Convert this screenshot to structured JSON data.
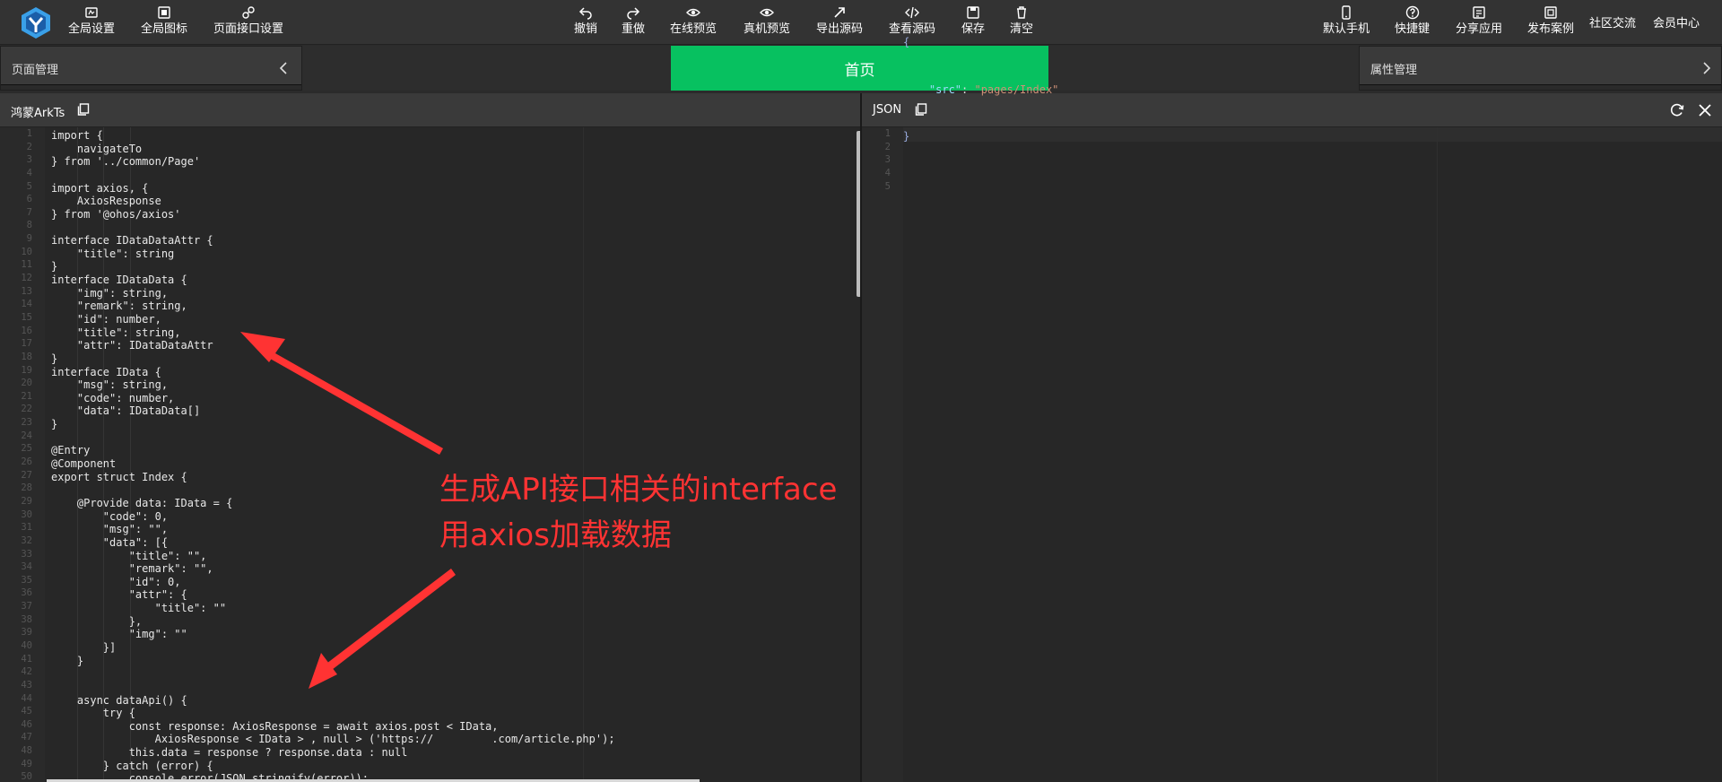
{
  "toolbar": {
    "left": [
      {
        "label": "全局设置",
        "icon": "global-settings-icon"
      },
      {
        "label": "全局图标",
        "icon": "global-icons-icon"
      },
      {
        "label": "页面接口设置",
        "icon": "page-api-settings-icon"
      }
    ],
    "center": [
      {
        "label": "撤销",
        "icon": "undo-icon"
      },
      {
        "label": "重做",
        "icon": "redo-icon"
      },
      {
        "label": "在线预览",
        "icon": "eye-icon"
      },
      {
        "label": "真机预览",
        "icon": "eye-icon"
      },
      {
        "label": "导出源码",
        "icon": "export-icon"
      },
      {
        "label": "查看源码",
        "icon": "code-icon"
      },
      {
        "label": "保存",
        "icon": "save-icon"
      },
      {
        "label": "清空",
        "icon": "trash-icon"
      }
    ],
    "right": [
      {
        "label": "默认手机",
        "icon": "phone-icon"
      },
      {
        "label": "快捷键",
        "icon": "help-icon"
      },
      {
        "label": "分享应用",
        "icon": "share-app-icon"
      },
      {
        "label": "发布案例",
        "icon": "publish-case-icon"
      }
    ],
    "community": "社区交流",
    "member": "会员中心"
  },
  "panels": {
    "page_manage": "页面管理",
    "current_page": "首页",
    "property_manage": "属性管理"
  },
  "left_editor": {
    "title": "鸿蒙ArkTs",
    "lines": [
      "import {",
      "    navigateTo",
      "} from '../common/Page'",
      "",
      "import axios, {",
      "    AxiosResponse",
      "} from '@ohos/axios'",
      "",
      "interface IDataDataAttr {",
      "    \"title\": string",
      "}",
      "interface IDataData {",
      "    \"img\": string,",
      "    \"remark\": string,",
      "    \"id\": number,",
      "    \"title\": string,",
      "    \"attr\": IDataDataAttr",
      "}",
      "interface IData {",
      "    \"msg\": string,",
      "    \"code\": number,",
      "    \"data\": IDataData[]",
      "}",
      "",
      "@Entry",
      "@Component",
      "export struct Index {",
      "",
      "    @Provide data: IData = {",
      "        \"code\": 0,",
      "        \"msg\": \"\",",
      "        \"data\": [{",
      "            \"title\": \"\",",
      "            \"remark\": \"\",",
      "            \"id\": 0,",
      "            \"attr\": {",
      "                \"title\": \"\"",
      "            },",
      "            \"img\": \"\"",
      "        }]",
      "    }",
      "",
      "",
      "    async dataApi() {",
      "        try {",
      "            const response: AxiosResponse = await axios.post < IData,",
      "                AxiosResponse < IData > , null > ('https://         .com/article.php');",
      "            this.data = response ? response.data : null",
      "        } catch (error) {",
      "            console.error(JSON.stringify(error));"
    ]
  },
  "right_editor": {
    "title": "JSON",
    "line_count": 5,
    "json": {
      "open": "{",
      "key": "\"src\"",
      "colon": ": ",
      "value": "\"pages/Index\"",
      "close": "}"
    }
  },
  "annotation": {
    "line1": "生成API接口相关的interface",
    "line2": "用axios加载数据"
  },
  "colors": {
    "accent": "#07c160",
    "annotation": "#ff3333",
    "toolbar": "#333333"
  }
}
